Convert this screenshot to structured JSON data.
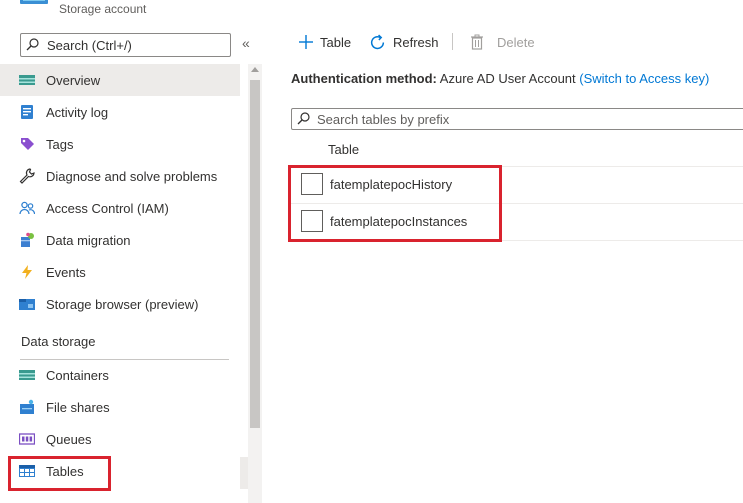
{
  "header": {
    "subtitle": "Storage account"
  },
  "nav": {
    "search_placeholder": "Search (Ctrl+/)",
    "collapse_glyph": "«",
    "items": [
      {
        "label": "Overview",
        "icon": "overview-icon",
        "active": true
      },
      {
        "label": "Activity log",
        "icon": "activity-log-icon"
      },
      {
        "label": "Tags",
        "icon": "tag-icon"
      },
      {
        "label": "Diagnose and solve problems",
        "icon": "wrench-icon"
      },
      {
        "label": "Access Control (IAM)",
        "icon": "people-icon"
      },
      {
        "label": "Data migration",
        "icon": "data-migration-icon"
      },
      {
        "label": "Events",
        "icon": "lightning-icon"
      },
      {
        "label": "Storage browser (preview)",
        "icon": "storage-browser-icon"
      }
    ],
    "section_title": "Data storage",
    "storage_items": [
      {
        "label": "Containers",
        "icon": "containers-icon"
      },
      {
        "label": "File shares",
        "icon": "file-shares-icon"
      },
      {
        "label": "Queues",
        "icon": "queues-icon"
      },
      {
        "label": "Tables",
        "icon": "tables-icon"
      }
    ]
  },
  "toolbar": {
    "add_table_label": "Table",
    "refresh_label": "Refresh",
    "delete_label": "Delete"
  },
  "auth": {
    "label": "Authentication method:",
    "value": "Azure AD User Account",
    "link": "(Switch to Access key)"
  },
  "tables": {
    "search_placeholder": "Search tables by prefix",
    "column_header": "Table",
    "rows": [
      {
        "name": "fatemplatepocHistory"
      },
      {
        "name": "fatemplatepocInstances"
      }
    ]
  },
  "colors": {
    "accent": "#0078d4",
    "highlight": "#d9232e"
  }
}
